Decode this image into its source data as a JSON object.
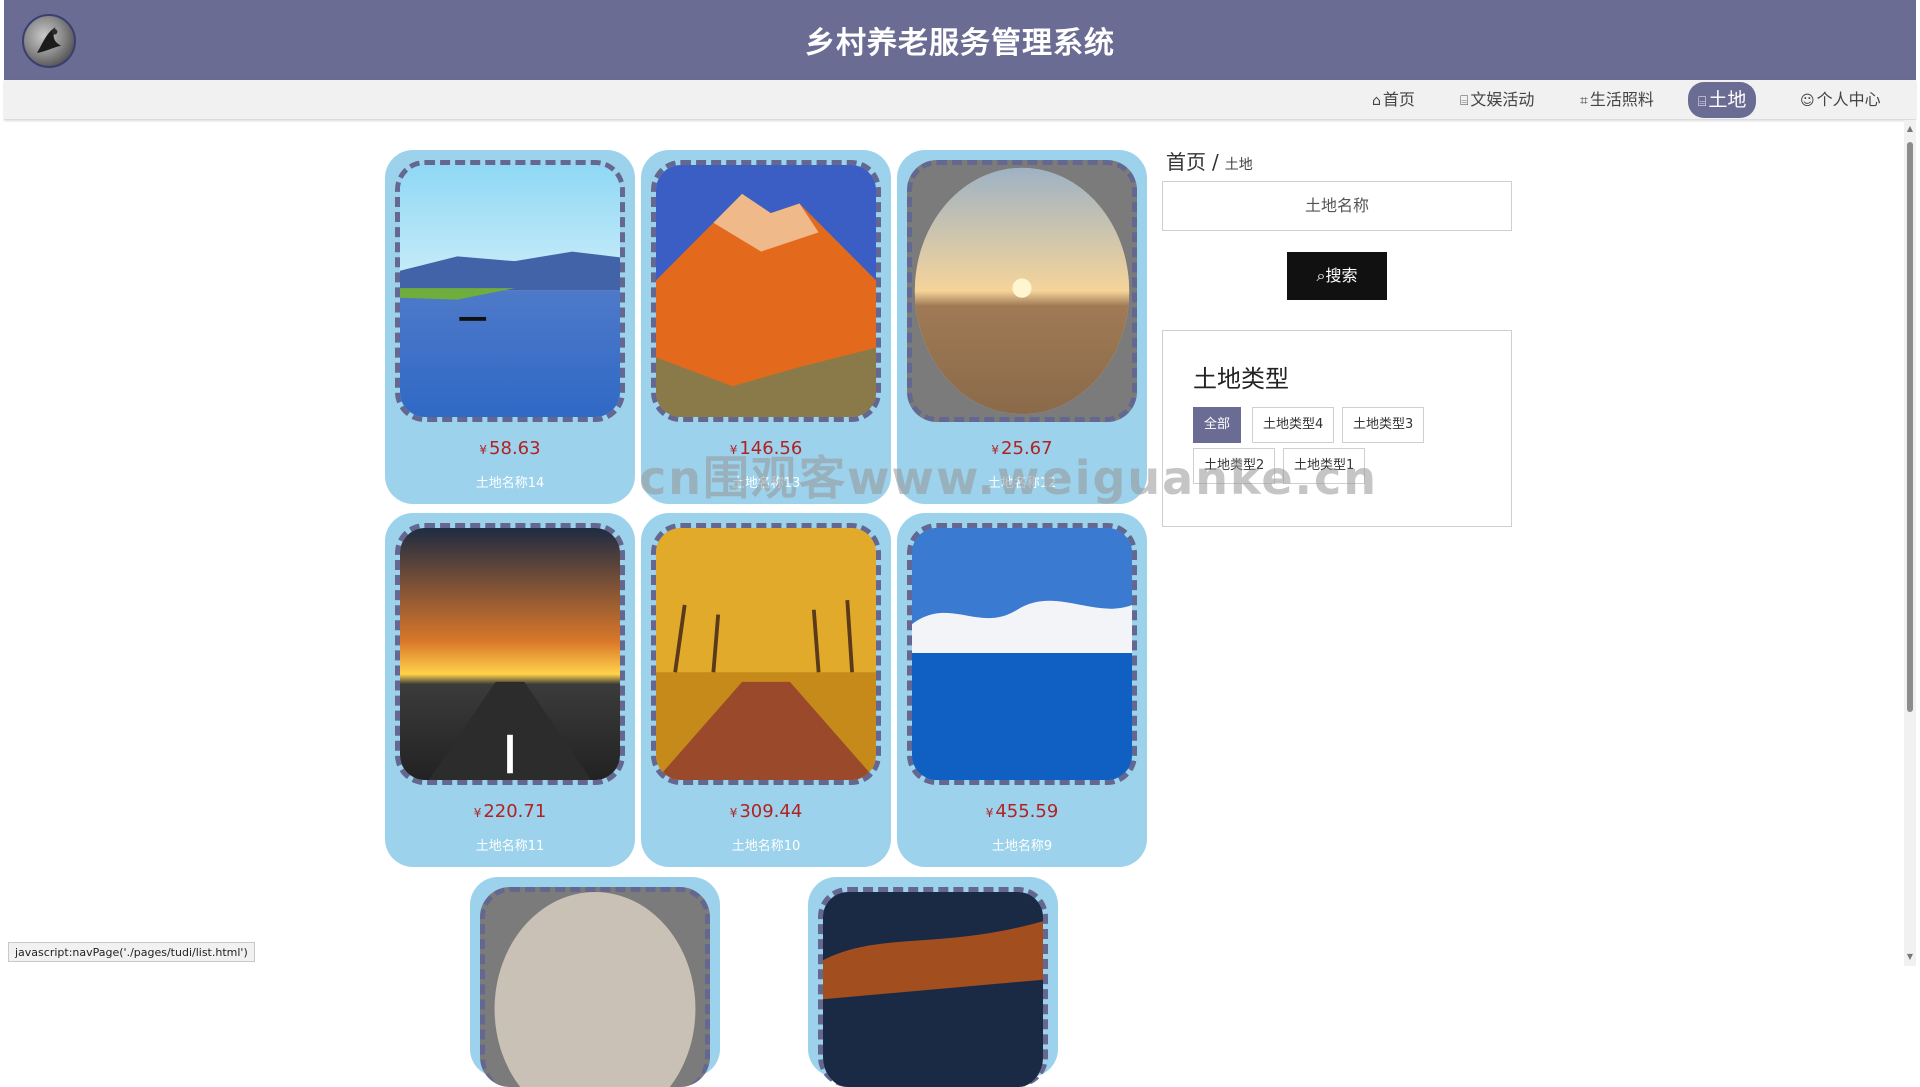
{
  "header": {
    "title": "乡村养老服务管理系统"
  },
  "nav": {
    "items": [
      {
        "icon": "⌂",
        "label": "首页"
      },
      {
        "icon": "⌸",
        "label": "文娱活动"
      },
      {
        "icon": "⌗",
        "label": "生活照料"
      },
      {
        "icon": "⌸",
        "label": "土地"
      },
      {
        "icon": "☺",
        "label": "个人中心"
      }
    ],
    "active": "土地"
  },
  "breadcrumb": {
    "home": "首页",
    "sep": "/",
    "current": "土地"
  },
  "search": {
    "placeholder": "土地名称",
    "button_label": "搜索",
    "button_icon": "⌕"
  },
  "types": {
    "title": "土地类型",
    "tags": [
      "全部",
      "土地类型4",
      "土地类型3",
      "土地类型2",
      "土地类型1"
    ],
    "active": "全部"
  },
  "products": [
    {
      "price": "58.63",
      "currency": "¥",
      "name": "土地名称14",
      "image": "lake-boat"
    },
    {
      "price": "146.56",
      "currency": "¥",
      "name": "土地名称13",
      "image": "red-mountain"
    },
    {
      "price": "25.67",
      "currency": "¥",
      "name": "土地名称12",
      "image": "desert-sunset"
    },
    {
      "price": "220.71",
      "currency": "¥",
      "name": "土地名称11",
      "image": "road-sunset"
    },
    {
      "price": "309.44",
      "currency": "¥",
      "name": "土地名称10",
      "image": "autumn-trees"
    },
    {
      "price": "455.59",
      "currency": "¥",
      "name": "土地名称9",
      "image": "blue-lake-mountains"
    },
    {
      "image": "desert-sunset"
    },
    {
      "image": "dusk-sky"
    }
  ],
  "watermark": "cn围观客www.weiguanke.cn",
  "status_bar": "javascript:navPage('./pages/tudi/list.html')",
  "colors": {
    "header": "#6b6c93",
    "card": "#9cd2ec",
    "price": "#b22222"
  }
}
